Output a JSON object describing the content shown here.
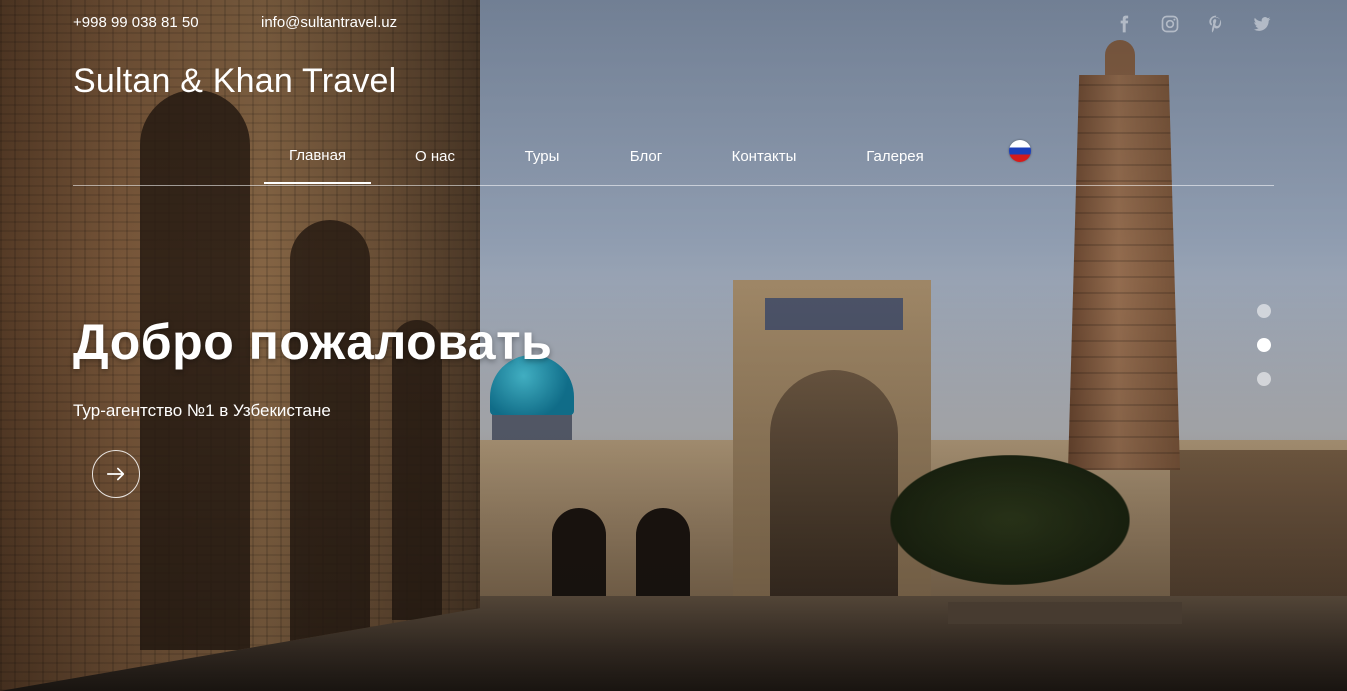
{
  "contact": {
    "phone": "+998 99 038 81 50",
    "email": "info@sultantravel.uz"
  },
  "socials": [
    "facebook-icon",
    "instagram-icon",
    "pinterest-icon",
    "twitter-icon"
  ],
  "brand": "Sultan & Khan Travel",
  "nav": {
    "items": [
      {
        "label": "Главная",
        "active": true
      },
      {
        "label": "О нас"
      },
      {
        "label": "Туры"
      },
      {
        "label": "Блог"
      },
      {
        "label": "Контакты"
      },
      {
        "label": "Галерея"
      }
    ],
    "language_flag": "ru-flag-icon"
  },
  "hero": {
    "title": "Добро пожаловать",
    "subtitle": "Тур-агентство №1 в Узбекистане",
    "cta_icon": "arrow-right-icon"
  },
  "slider": {
    "count": 3,
    "active_index": 1
  },
  "colors": {
    "text": "#ffffff",
    "sky": "#9aa8bd",
    "brick": "#8c6a48",
    "dome": "#2aa3c0"
  }
}
